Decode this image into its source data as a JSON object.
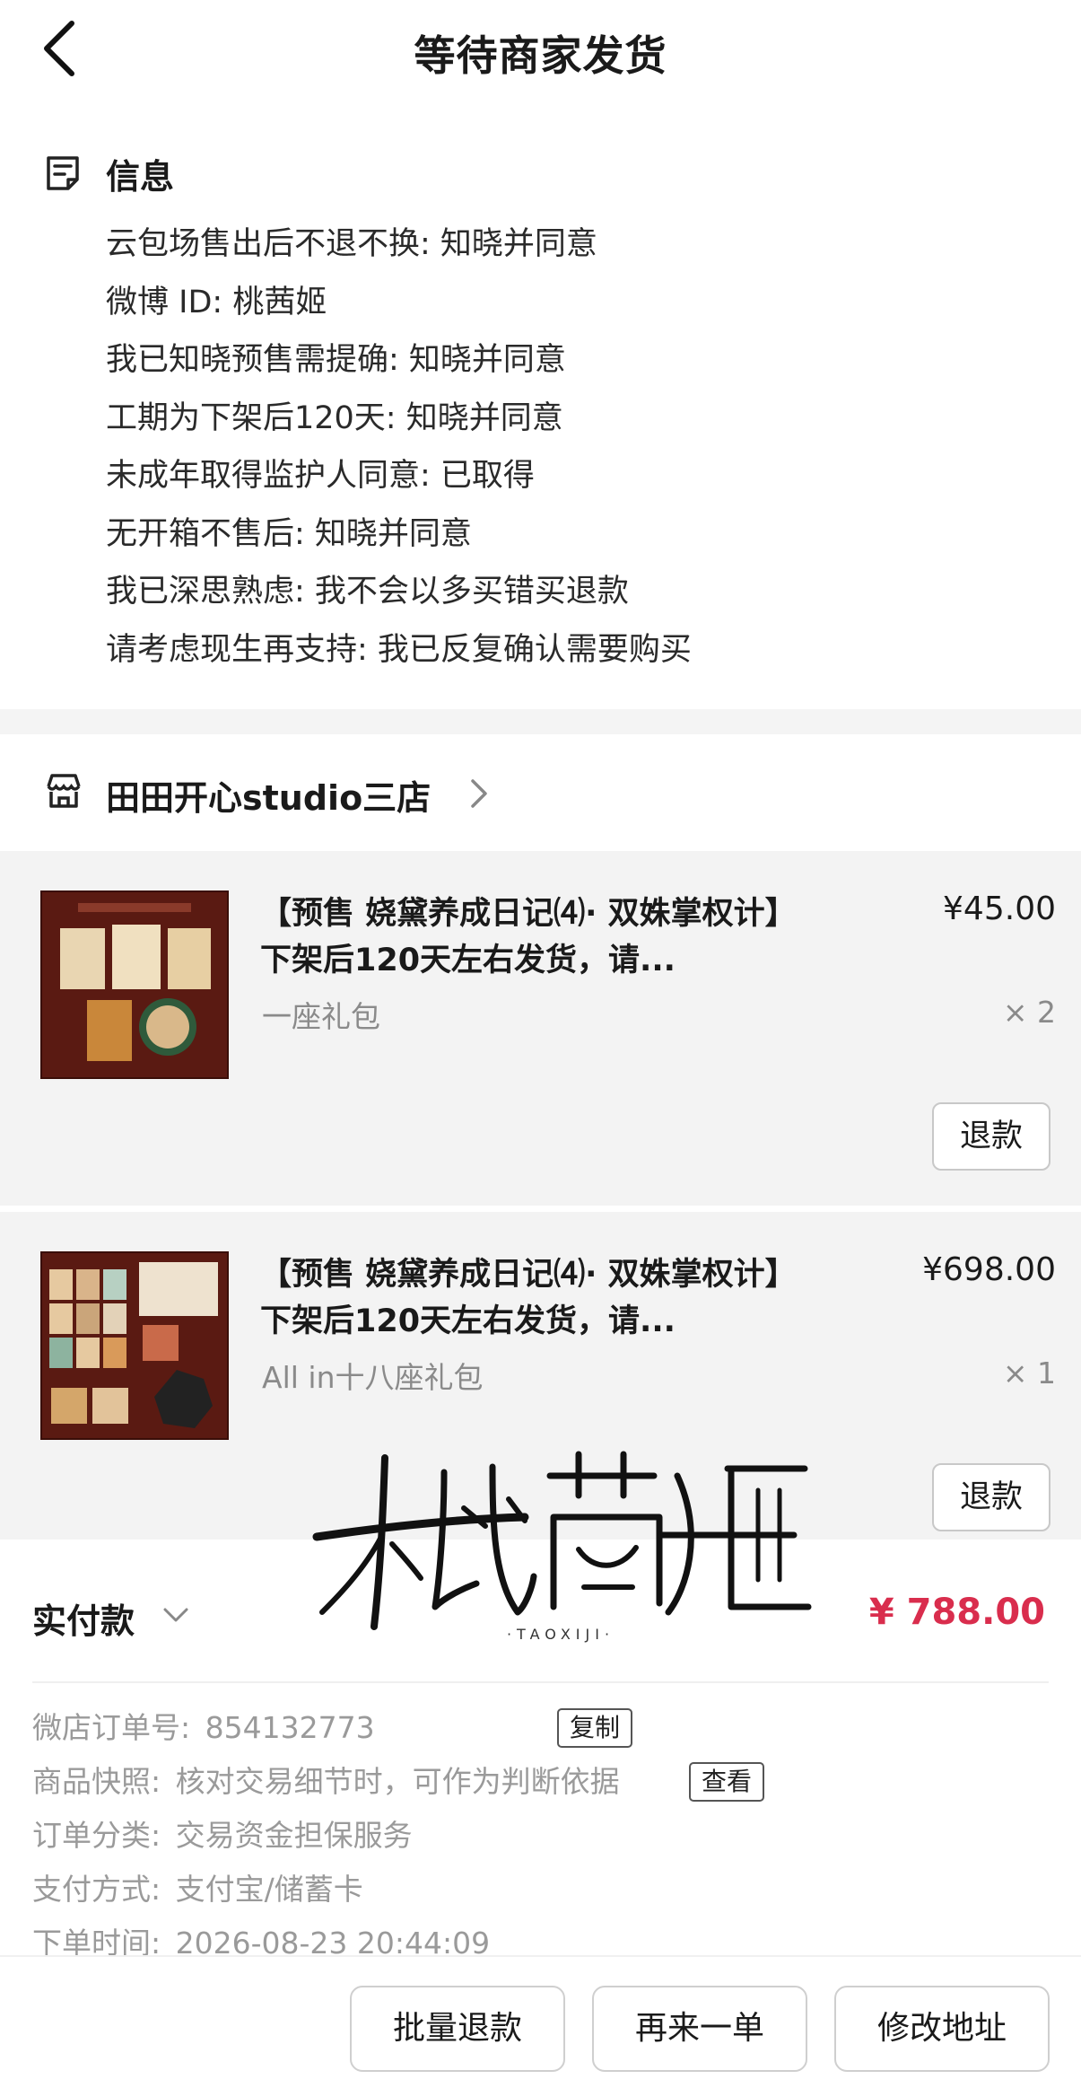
{
  "header": {
    "title": "等待商家发货"
  },
  "info": {
    "title": "信息",
    "lines": [
      "云包场售出后不退不换: 知晓并同意",
      "微博 ID: 桃茜姬",
      "我已知晓预售需提确: 知晓并同意",
      "工期为下架后120天: 知晓并同意",
      "未成年取得监护人同意: 已取得",
      "无开箱不售后: 知晓并同意",
      "我已深思熟虑: 我不会以多买错买退款",
      "请考虑现生再支持: 我已反复确认需要购买"
    ]
  },
  "shop": {
    "name": "田田开心studio三店"
  },
  "items": [
    {
      "title": "【预售 娆黛养成日记⑷· 双姝掌权计】下架后120天左右发货，请...",
      "variant": "一座礼包",
      "price": "¥45.00",
      "qty": "× 2",
      "refund_label": "退款"
    },
    {
      "title": "【预售 娆黛养成日记⑷· 双姝掌权计】下架后120天左右发货，请...",
      "variant": "All in十八座礼包",
      "price": "¥698.00",
      "qty": "× 1",
      "refund_label": "退款"
    }
  ],
  "watermark": {
    "text": "桃茜姬",
    "sub": "·TAOXIJI·"
  },
  "payment": {
    "label": "实付款",
    "amount": "¥ 788.00"
  },
  "details": {
    "order_no_label": "微店订单号:",
    "order_no": "854132773",
    "copy_label": "复制",
    "snapshot_label": "商品快照:",
    "snapshot_value": "核对交易细节时，可作为判断依据",
    "view_label": "查看",
    "category_label": "订单分类:",
    "category_value": "交易资金担保服务",
    "pay_method_label": "支付方式:",
    "pay_method_value": "支付宝/储蓄卡",
    "time_label": "下单时间:",
    "time_value": "2026-08-23 20:44:09"
  },
  "bottom_bar": {
    "batch_refund": "批量退款",
    "reorder": "再来一单",
    "change_address": "修改地址"
  },
  "colors": {
    "accent": "#d92d4d",
    "thumb_bg": "#5a1a12",
    "item_bg": "#f3f3f3"
  }
}
